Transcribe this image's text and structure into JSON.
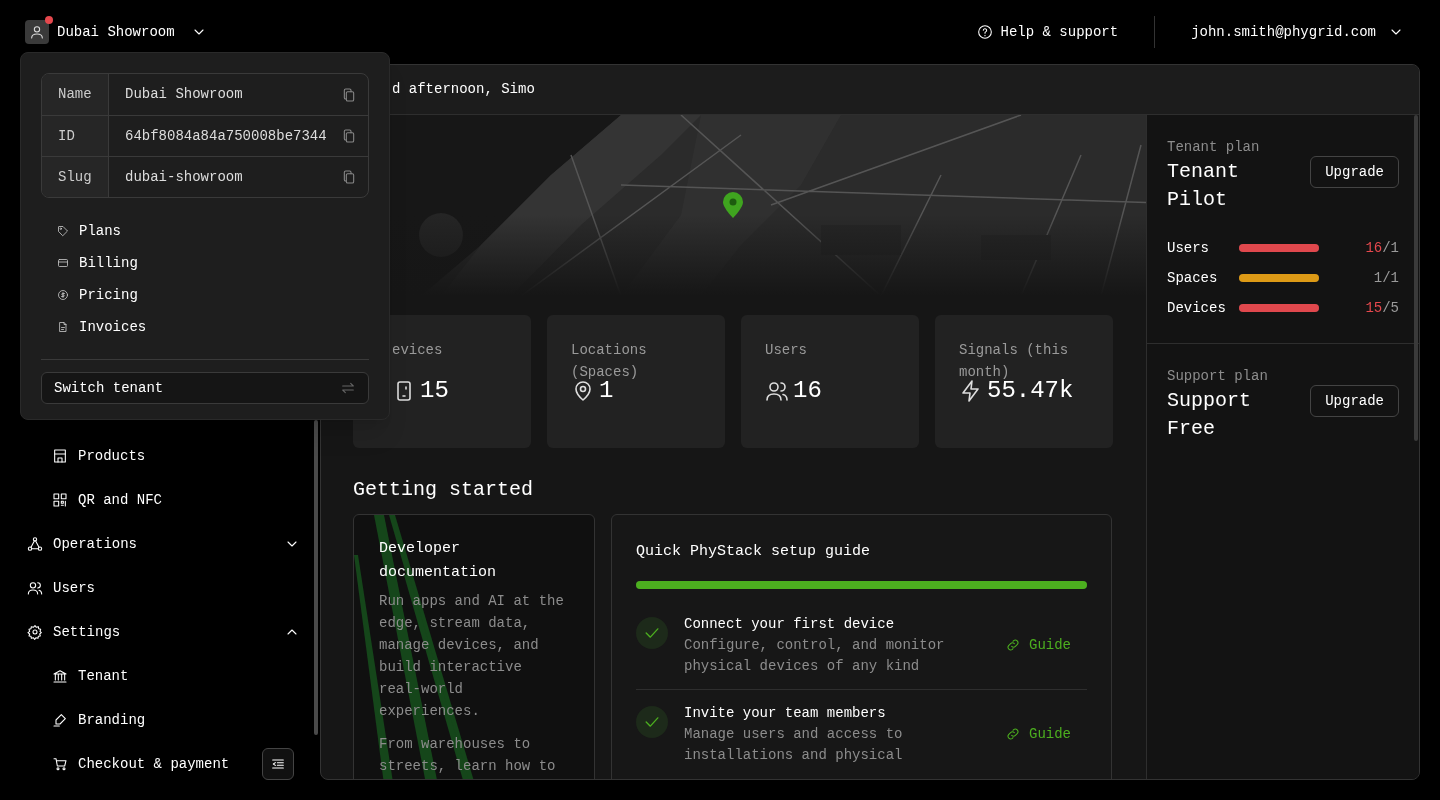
{
  "topbar": {
    "tenant": "Dubai Showroom",
    "notification": true,
    "help": "Help & support",
    "account": "john.smith@phygrid.com"
  },
  "tenant_menu": {
    "details": [
      {
        "label": "Name",
        "value": "Dubai Showroom"
      },
      {
        "label": "ID",
        "value": "64bf8084a84a750008be7344"
      },
      {
        "label": "Slug",
        "value": "dubai-showroom"
      }
    ],
    "items": [
      {
        "label": "Plans"
      },
      {
        "label": "Billing"
      },
      {
        "label": "Pricing"
      },
      {
        "label": "Invoices"
      }
    ],
    "switch_button": "Switch tenant"
  },
  "sidebar": {
    "items": [
      {
        "children": [
          {
            "label": "Products"
          },
          {
            "label": "QR and NFC"
          }
        ]
      },
      {
        "label": "Operations",
        "expanded": false
      },
      {
        "label": "Users"
      },
      {
        "label": "Settings",
        "expanded": true,
        "children": [
          {
            "label": "Tenant"
          },
          {
            "label": "Branding"
          },
          {
            "label": "Checkout & payment"
          }
        ]
      }
    ]
  },
  "main": {
    "greeting": "d afternoon, Simo",
    "stats": [
      {
        "label": "evices",
        "value": "15"
      },
      {
        "label": "Locations (Spaces)",
        "value": "1"
      },
      {
        "label": "Users",
        "value": "16"
      },
      {
        "label": "Signals (this month)",
        "value": "55.47k"
      }
    ],
    "getting_started": {
      "heading": "Getting started",
      "docs": {
        "title": "Developer documentation",
        "paragraphs": [
          "Run apps and AI at the edge, stream data, manage devices, and build interactive real-world experiences.",
          "From warehouses to streets, learn how to"
        ]
      },
      "guide": {
        "title": "Quick PhyStack setup guide",
        "level": 1,
        "steps": [
          {
            "title": "Connect your first device",
            "description": "Configure, control, and monitor physical devices of any kind",
            "done": true,
            "link": "Guide"
          },
          {
            "title": "Invite your team members",
            "description": "Manage users and access to installations and physical",
            "done": true,
            "link": "Guide"
          }
        ]
      }
    }
  },
  "plans": [
    {
      "label": "Tenant plan",
      "name": "Tenant Pilot",
      "button": "Upgrade",
      "usage": [
        {
          "label": "Users",
          "used": "16",
          "limit": "/1",
          "level": 1,
          "color": "#e0484d",
          "exceeded": true
        },
        {
          "label": "Spaces",
          "used": "1",
          "limit": "/1",
          "level": 1,
          "color": "#dd9a16",
          "exceeded": false
        },
        {
          "label": "Devices",
          "used": "15",
          "limit": "/5",
          "level": 1,
          "color": "#e0484d",
          "exceeded": true
        }
      ]
    },
    {
      "label": "Support plan",
      "name": "Support Free",
      "button": "Upgrade"
    }
  ]
}
